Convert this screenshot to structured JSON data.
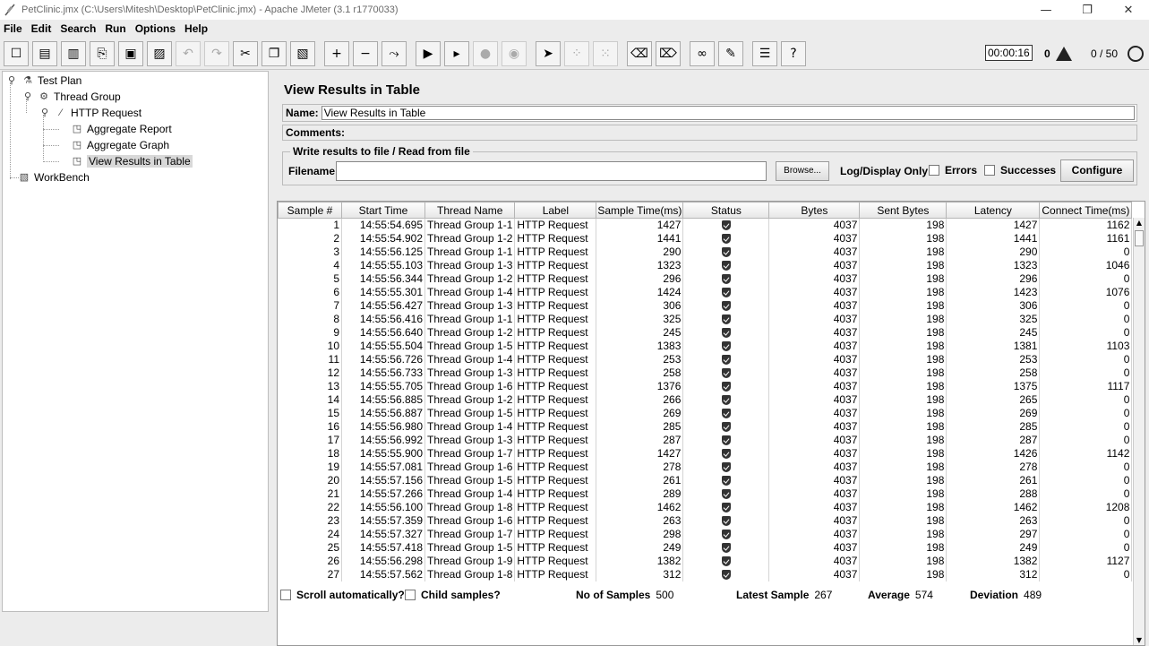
{
  "window": {
    "title": "PetClinic.jmx (C:\\Users\\Mitesh\\Desktop\\PetClinic.jmx) - Apache JMeter (3.1 r1770033)",
    "minimize": "—",
    "maximize": "❐",
    "close": "✕"
  },
  "menu": [
    "File",
    "Edit",
    "Search",
    "Run",
    "Options",
    "Help"
  ],
  "status": {
    "timer": "00:00:16",
    "warnings": "0",
    "threads": "0 / 50"
  },
  "tree": {
    "test_plan": "Test Plan",
    "thread_group": "Thread Group",
    "http_request": "HTTP Request",
    "aggregate_report": "Aggregate Report",
    "aggregate_graph": "Aggregate Graph",
    "view_results": "View Results in Table",
    "workbench": "WorkBench"
  },
  "panel": {
    "title": "View Results in Table",
    "name_label": "Name:",
    "name_value": "View Results in Table",
    "comments_label": "Comments:",
    "file_legend": "Write results to file / Read from file",
    "filename_label": "Filename",
    "browse": "Browse...",
    "log_display": "Log/Display Only:",
    "errors": "Errors",
    "successes": "Successes",
    "configure": "Configure"
  },
  "table": {
    "columns": [
      "Sample #",
      "Start Time",
      "Thread Name",
      "Label",
      "Sample Time(ms)",
      "Status",
      "Bytes",
      "Sent Bytes",
      "Latency",
      "Connect Time(ms)"
    ],
    "rows": [
      [
        "1",
        "14:55:54.695",
        "Thread Group 1-1",
        "HTTP Request",
        "1427",
        "",
        "4037",
        "198",
        "1427",
        "1162"
      ],
      [
        "2",
        "14:55:54.902",
        "Thread Group 1-2",
        "HTTP Request",
        "1441",
        "",
        "4037",
        "198",
        "1441",
        "1161"
      ],
      [
        "3",
        "14:55:56.125",
        "Thread Group 1-1",
        "HTTP Request",
        "290",
        "",
        "4037",
        "198",
        "290",
        "0"
      ],
      [
        "4",
        "14:55:55.103",
        "Thread Group 1-3",
        "HTTP Request",
        "1323",
        "",
        "4037",
        "198",
        "1323",
        "1046"
      ],
      [
        "5",
        "14:55:56.344",
        "Thread Group 1-2",
        "HTTP Request",
        "296",
        "",
        "4037",
        "198",
        "296",
        "0"
      ],
      [
        "6",
        "14:55:55.301",
        "Thread Group 1-4",
        "HTTP Request",
        "1424",
        "",
        "4037",
        "198",
        "1423",
        "1076"
      ],
      [
        "7",
        "14:55:56.427",
        "Thread Group 1-3",
        "HTTP Request",
        "306",
        "",
        "4037",
        "198",
        "306",
        "0"
      ],
      [
        "8",
        "14:55:56.416",
        "Thread Group 1-1",
        "HTTP Request",
        "325",
        "",
        "4037",
        "198",
        "325",
        "0"
      ],
      [
        "9",
        "14:55:56.640",
        "Thread Group 1-2",
        "HTTP Request",
        "245",
        "",
        "4037",
        "198",
        "245",
        "0"
      ],
      [
        "10",
        "14:55:55.504",
        "Thread Group 1-5",
        "HTTP Request",
        "1383",
        "",
        "4037",
        "198",
        "1381",
        "1103"
      ],
      [
        "11",
        "14:55:56.726",
        "Thread Group 1-4",
        "HTTP Request",
        "253",
        "",
        "4037",
        "198",
        "253",
        "0"
      ],
      [
        "12",
        "14:55:56.733",
        "Thread Group 1-3",
        "HTTP Request",
        "258",
        "",
        "4037",
        "198",
        "258",
        "0"
      ],
      [
        "13",
        "14:55:55.705",
        "Thread Group 1-6",
        "HTTP Request",
        "1376",
        "",
        "4037",
        "198",
        "1375",
        "1117"
      ],
      [
        "14",
        "14:55:56.885",
        "Thread Group 1-2",
        "HTTP Request",
        "266",
        "",
        "4037",
        "198",
        "265",
        "0"
      ],
      [
        "15",
        "14:55:56.887",
        "Thread Group 1-5",
        "HTTP Request",
        "269",
        "",
        "4037",
        "198",
        "269",
        "0"
      ],
      [
        "16",
        "14:55:56.980",
        "Thread Group 1-4",
        "HTTP Request",
        "285",
        "",
        "4037",
        "198",
        "285",
        "0"
      ],
      [
        "17",
        "14:55:56.992",
        "Thread Group 1-3",
        "HTTP Request",
        "287",
        "",
        "4037",
        "198",
        "287",
        "0"
      ],
      [
        "18",
        "14:55:55.900",
        "Thread Group 1-7",
        "HTTP Request",
        "1427",
        "",
        "4037",
        "198",
        "1426",
        "1142"
      ],
      [
        "19",
        "14:55:57.081",
        "Thread Group 1-6",
        "HTTP Request",
        "278",
        "",
        "4037",
        "198",
        "278",
        "0"
      ],
      [
        "20",
        "14:55:57.156",
        "Thread Group 1-5",
        "HTTP Request",
        "261",
        "",
        "4037",
        "198",
        "261",
        "0"
      ],
      [
        "21",
        "14:55:57.266",
        "Thread Group 1-4",
        "HTTP Request",
        "289",
        "",
        "4037",
        "198",
        "288",
        "0"
      ],
      [
        "22",
        "14:55:56.100",
        "Thread Group 1-8",
        "HTTP Request",
        "1462",
        "",
        "4037",
        "198",
        "1462",
        "1208"
      ],
      [
        "23",
        "14:55:57.359",
        "Thread Group 1-6",
        "HTTP Request",
        "263",
        "",
        "4037",
        "198",
        "263",
        "0"
      ],
      [
        "24",
        "14:55:57.327",
        "Thread Group 1-7",
        "HTTP Request",
        "298",
        "",
        "4037",
        "198",
        "297",
        "0"
      ],
      [
        "25",
        "14:55:57.418",
        "Thread Group 1-5",
        "HTTP Request",
        "249",
        "",
        "4037",
        "198",
        "249",
        "0"
      ],
      [
        "26",
        "14:55:56.298",
        "Thread Group 1-9",
        "HTTP Request",
        "1382",
        "",
        "4037",
        "198",
        "1382",
        "1127"
      ],
      [
        "27",
        "14:55:57.562",
        "Thread Group 1-8",
        "HTTP Request",
        "312",
        "",
        "4037",
        "198",
        "312",
        "0"
      ]
    ]
  },
  "footer": {
    "scroll_auto": "Scroll automatically?",
    "child_samples": "Child samples?",
    "no_samples_label": "No of Samples",
    "no_samples_value": "500",
    "latest_label": "Latest Sample",
    "latest_value": "267",
    "average_label": "Average",
    "average_value": "574",
    "deviation_label": "Deviation",
    "deviation_value": "489"
  }
}
